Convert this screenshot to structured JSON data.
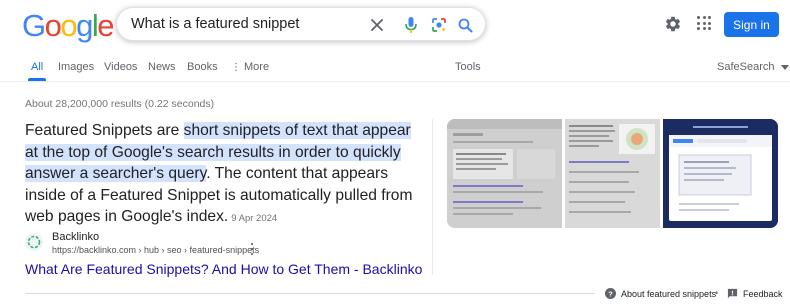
{
  "header": {
    "logo_letters": [
      "G",
      "o",
      "o",
      "g",
      "l",
      "e"
    ],
    "logo_colors": [
      "#4285F4",
      "#EA4335",
      "#FBBC05",
      "#4285F4",
      "#34A853",
      "#EA4335"
    ],
    "query": "What is a featured snippet",
    "sign_in_label": "Sign in"
  },
  "tabs": {
    "items": [
      "All",
      "Images",
      "Videos",
      "News",
      "Books"
    ],
    "more": "More",
    "tools": "Tools",
    "safesearch": "SafeSearch"
  },
  "stats": "About 28,200,000 results (0.22 seconds)",
  "snippet": {
    "lead": "Featured Snippets are ",
    "highlight": "short snippets of text that appear at the top of Google's search results in order to quickly answer a searcher's query",
    "rest": ". The content that appears inside of a Featured Snippet is automatically pulled from web pages in Google's index.",
    "date": "9 Apr 2024"
  },
  "source": {
    "name": "Backlinko",
    "url": "https://backlinko.com › hub › seo › featured-snippets",
    "title": "What Are Featured Snippets? And How to Get Them - Backlinko"
  },
  "footer": {
    "about": "About featured snippets",
    "separator": "•",
    "feedback": "Feedback"
  },
  "colors": {
    "accent": "#1a73e8",
    "link": "#1a0dab",
    "highlight": "#d3e3fd"
  }
}
